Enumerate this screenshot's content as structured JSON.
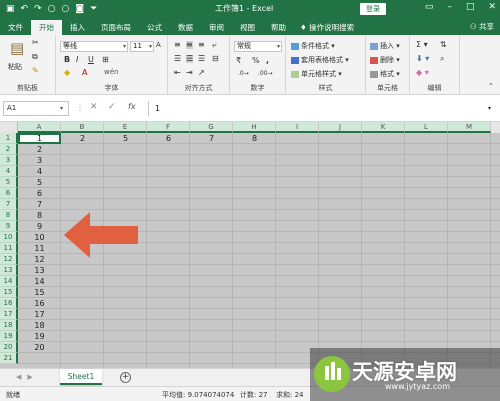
{
  "window": {
    "title": "工作簿1 - Excel",
    "login_label": "登录",
    "share_label": "共享",
    "qat_icons": [
      "save-icon",
      "undo-icon",
      "redo-icon",
      "circle-icon",
      "circle-icon",
      "camera-icon",
      "customize-icon"
    ]
  },
  "ribbon_tabs": [
    "文件",
    "开始",
    "插入",
    "页面布局",
    "公式",
    "数据",
    "审阅",
    "视图",
    "帮助"
  ],
  "active_tab": "开始",
  "tell_me": "操作说明搜索",
  "clipboard": {
    "paste": "粘贴",
    "label": "剪贴板"
  },
  "font": {
    "name": "等线",
    "size": "11",
    "label": "字体",
    "bold": "B",
    "italic": "I",
    "underline": "U"
  },
  "alignment": {
    "label": "对齐方式"
  },
  "number": {
    "format": "常规",
    "label": "数字",
    "percent": "%",
    "comma": ","
  },
  "styles": {
    "conditional": "条件格式",
    "table": "套用表格格式",
    "cell": "单元格样式",
    "label": "样式"
  },
  "cells": {
    "insert": "插入",
    "delete": "删除",
    "format": "格式",
    "label": "单元格"
  },
  "editing": {
    "label": "编辑"
  },
  "formula_bar": {
    "name_box": "A1",
    "content": "1"
  },
  "columns": [
    "A",
    "B",
    "E",
    "F",
    "G",
    "H",
    "I",
    "J",
    "K",
    "L",
    "M"
  ],
  "rows": [
    "1",
    "2",
    "3",
    "4",
    "5",
    "6",
    "7",
    "8",
    "9",
    "10",
    "11",
    "12",
    "13",
    "14",
    "15",
    "16",
    "17",
    "18",
    "19",
    "20",
    "21"
  ],
  "row1_values": [
    "2",
    "5",
    "6",
    "7",
    "8"
  ],
  "colA_values": [
    "1",
    "2",
    "3",
    "4",
    "5",
    "6",
    "7",
    "8",
    "9",
    "10",
    "11",
    "12",
    "13",
    "14",
    "15",
    "16",
    "17",
    "18",
    "19",
    "20"
  ],
  "sheet_tab": "Sheet1",
  "status": {
    "ready": "就绪",
    "average": "平均值: 9.074074074",
    "count": "计数: 27",
    "sum": "求和: 24"
  },
  "watermark": {
    "text": "天源安卓网",
    "url": "www.jytyaz.com"
  },
  "colors": {
    "brand": "#217346",
    "arrow": "#e06040"
  }
}
